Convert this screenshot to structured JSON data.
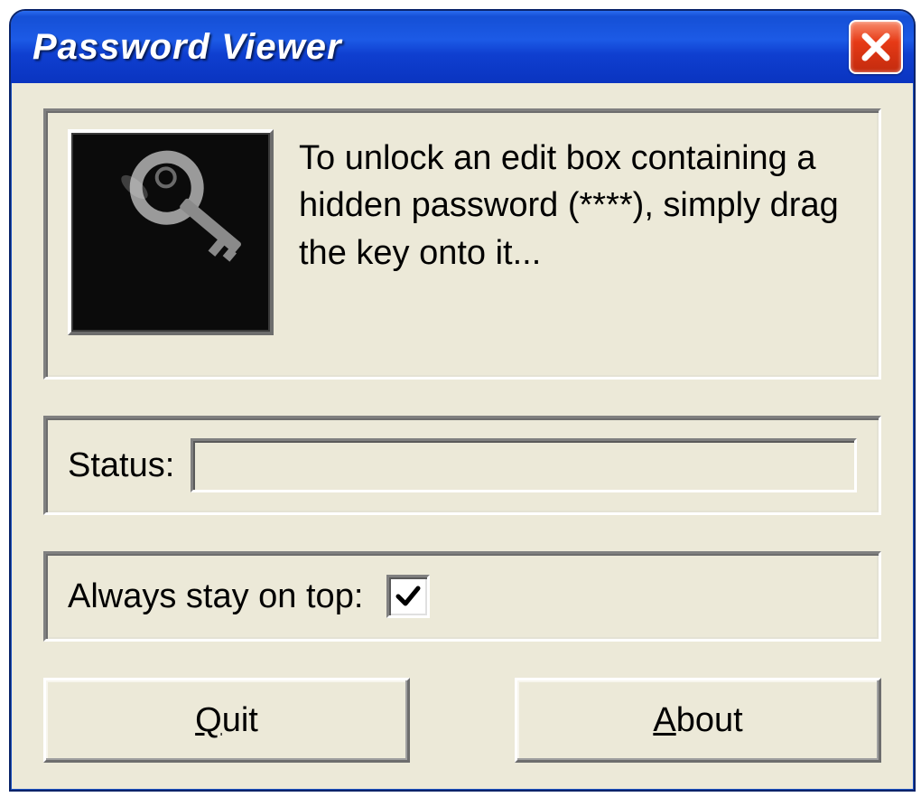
{
  "window": {
    "title": "Password Viewer"
  },
  "instructions": {
    "text": "To unlock an edit box containing a hidden password (****), simply drag the key onto it..."
  },
  "status": {
    "label": "Status:",
    "value": ""
  },
  "stay_on_top": {
    "label": "Always stay on top:",
    "checked": true
  },
  "buttons": {
    "quit_prefix": "Q",
    "quit_rest": "uit",
    "about_prefix": "A",
    "about_rest": "bout"
  }
}
